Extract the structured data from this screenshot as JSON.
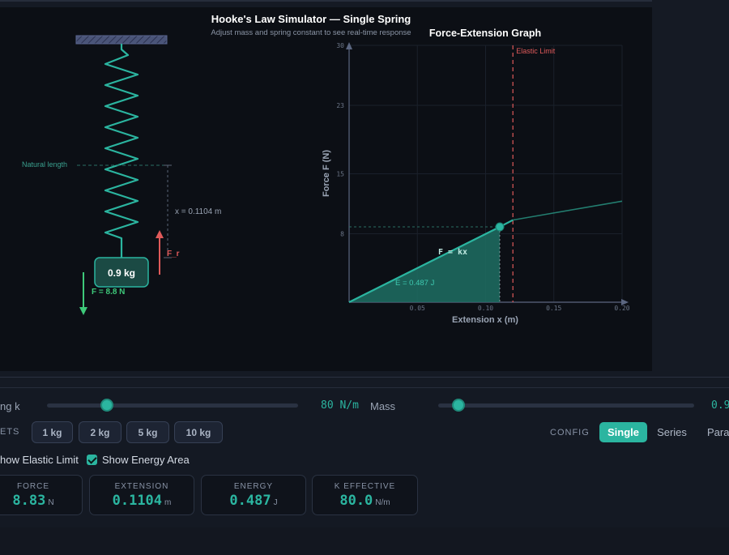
{
  "sim": {
    "title": "Hooke's Law Simulator — Single Spring",
    "subtitle": "Adjust mass and spring constant to see real-time response",
    "natural_length_label": "Natural length",
    "extension_label": "x = 0.1104 m",
    "mass_label": "0.9 kg",
    "gravity_force_label": "F = 8.8 N",
    "restoring_force_label": "F_r",
    "colors": {
      "accent": "#2bb5a0",
      "restoring": "#e05a5a",
      "gravity": "#3ec97a"
    }
  },
  "chart_data": {
    "type": "line",
    "title": "Force-Extension Graph",
    "xlabel": "Extension x (m)",
    "ylabel": "Force F (N)",
    "xlim": [
      0,
      0.2
    ],
    "ylim": [
      0,
      30
    ],
    "x_ticks": [
      "0.05",
      "0.10",
      "0.15",
      "0.20"
    ],
    "y_ticks": [
      "8",
      "15",
      "23",
      "30"
    ],
    "series": [
      {
        "values": [
          [
            0,
            0
          ],
          [
            0.1104,
            8.8
          ],
          [
            0.12,
            9.6
          ],
          [
            0.2,
            11.8
          ]
        ]
      }
    ],
    "current_point": {
      "x": 0.1104,
      "y": 8.8
    },
    "elastic_limit_x": 0.12,
    "elastic_limit_label": "Elastic Limit",
    "formula_label": "F = kx",
    "energy_label": "E = 0.487 J"
  },
  "controls": {
    "spring_k_label": "ng k",
    "spring_k_value": "80 N/m",
    "spring_k_fraction": 0.24,
    "mass_label": "Mass",
    "mass_value": "0.9",
    "mass_fraction": 0.08,
    "presets_label": "ETS",
    "presets": [
      "1 kg",
      "2 kg",
      "5 kg",
      "10 kg"
    ],
    "config_label": "CONFIG",
    "config_options": [
      "Single",
      "Series",
      "Paral"
    ],
    "show_elastic_limit": "how Elastic Limit",
    "show_energy_area": "Show Energy Area"
  },
  "readouts": [
    {
      "title": "FORCE",
      "value": "8.83",
      "unit": "N"
    },
    {
      "title": "EXTENSION",
      "value": "0.1104",
      "unit": "m"
    },
    {
      "title": "ENERGY",
      "value": "0.487",
      "unit": "J"
    },
    {
      "title": "K EFFECTIVE",
      "value": "80.0",
      "unit": "N/m"
    }
  ]
}
